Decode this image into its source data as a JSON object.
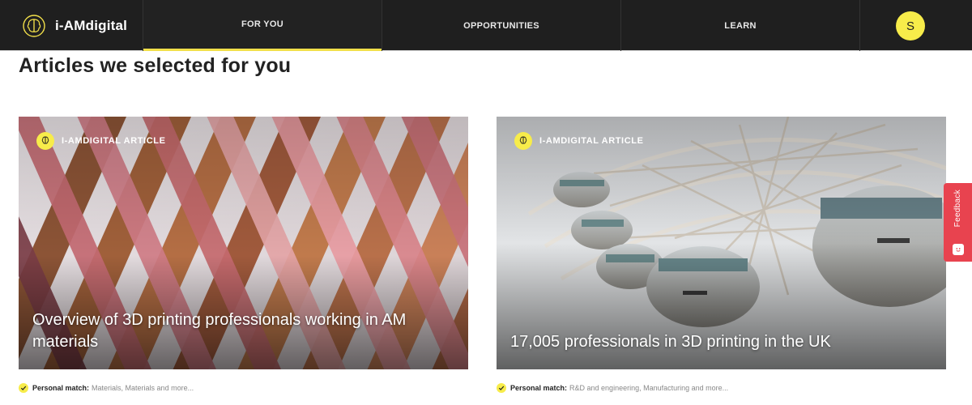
{
  "brand": {
    "name": "i-AMdigital",
    "icon": "brain-icon"
  },
  "nav": {
    "items": [
      {
        "label": "FOR YOU",
        "active": true
      },
      {
        "label": "OPPORTUNITIES",
        "active": false
      },
      {
        "label": "LEARN",
        "active": false
      }
    ],
    "avatar_letter": "S"
  },
  "page": {
    "title": "Articles we selected for you"
  },
  "articles": [
    {
      "badge": "I-AMDIGITAL ARTICLE",
      "title": "Overview of 3D printing professionals working in AM materials",
      "match_label": "Personal match:",
      "match_value": "Materials, Materials and more..."
    },
    {
      "badge": "I-AMDIGITAL ARTICLE",
      "title": "17,005 professionals in 3D printing in the UK",
      "match_label": "Personal match:",
      "match_value": "R&D and engineering, Manufacturing and more..."
    }
  ],
  "feedback": {
    "label": "Feedback",
    "color": "#e8434f"
  },
  "colors": {
    "accent": "#f7ec4a",
    "topbar": "#1f1f1f"
  }
}
